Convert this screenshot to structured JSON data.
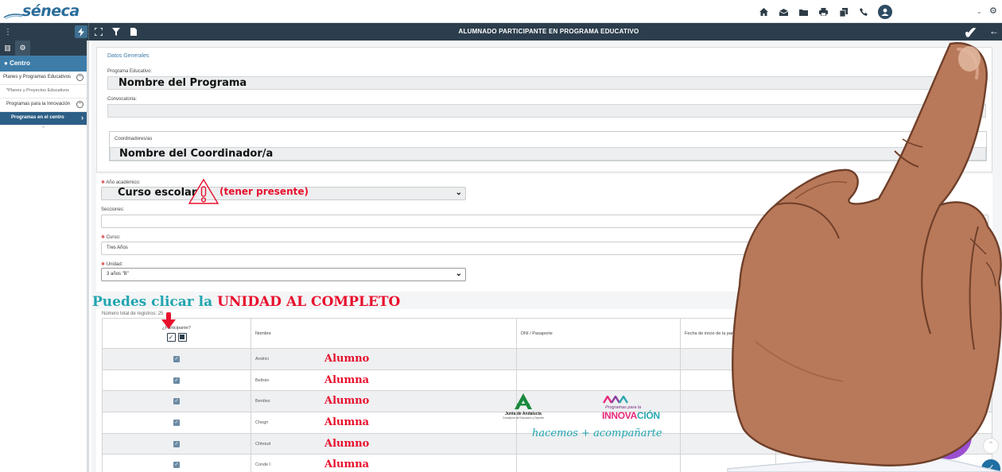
{
  "app": {
    "logo_text": "séneca",
    "page_title": "ALUMNADO PARTICIPANTE EN PROGRAMA EDUCATIVO"
  },
  "sidebar": {
    "section": "Centro",
    "items": [
      {
        "label": "Planes y Programas Educativos"
      },
      {
        "label": "*Planes y Proyectos Educativos"
      },
      {
        "label": "Programas para la Innovación"
      },
      {
        "label": "Programas en el centro"
      }
    ]
  },
  "datos_generales": {
    "heading": "Datos Generales",
    "programa_label": "Programa Educativo:",
    "programa_value": "Nombre del Programa",
    "convocatoria_label": "Convocatoria:",
    "coordinadores_label": "Coordinadores/as",
    "coordinadores_value": "Nombre del Coordinador/a"
  },
  "form": {
    "anio_label": "Año académico:",
    "anio_value": "Curso escolar",
    "anio_note": "(tener presente)",
    "secciones_label": "Secciones:",
    "curso_label": "Curso:",
    "curso_value": "Tres Años",
    "unidad_label": "Unidad:",
    "unidad_value": "3 años \"B\""
  },
  "callout": {
    "part1": "Puedes clicar la ",
    "part2": "UNIDAD AL COMPLETO"
  },
  "table": {
    "record_count_label": "Número total de registros: 25",
    "columns": {
      "participa": "¿Participante?",
      "nombre": "Nombre",
      "dni": "DNI / Pasaporte",
      "fecha": "Fecha de inicio de la participación *"
    },
    "rows": [
      {
        "surname": "Andrici",
        "tag": "Alumno"
      },
      {
        "surname": "Beltrán",
        "tag": "Alumna"
      },
      {
        "surname": "Benítez",
        "tag": "Alumno"
      },
      {
        "surname": "Chegri",
        "tag": "Alumna"
      },
      {
        "surname": "Chhoud",
        "tag": "Alumno"
      },
      {
        "surname": "Conde l",
        "tag": "Alumna"
      }
    ]
  },
  "branding": {
    "junta_name": "Junta de Andalucía",
    "junta_sub": "Consejería de Educación y Deporte",
    "innov_small": "Programas para la",
    "innov_big_1": "INNOVA",
    "innov_big_2": "CIÓN",
    "slogan": "hacemos + acompañarte"
  },
  "icons": {
    "home": "home-icon",
    "mail": "mail-icon",
    "folder": "folder-icon",
    "print": "print-icon",
    "copy": "copy-icon",
    "phone": "phone-icon",
    "user": "user-icon",
    "gear": "gear-icon"
  },
  "colors": {
    "header_dark": "#2c3e4d",
    "accent_blue": "#3e7ca8",
    "annotation_red": "#e8102d",
    "annotation_teal": "#20a5b0"
  }
}
